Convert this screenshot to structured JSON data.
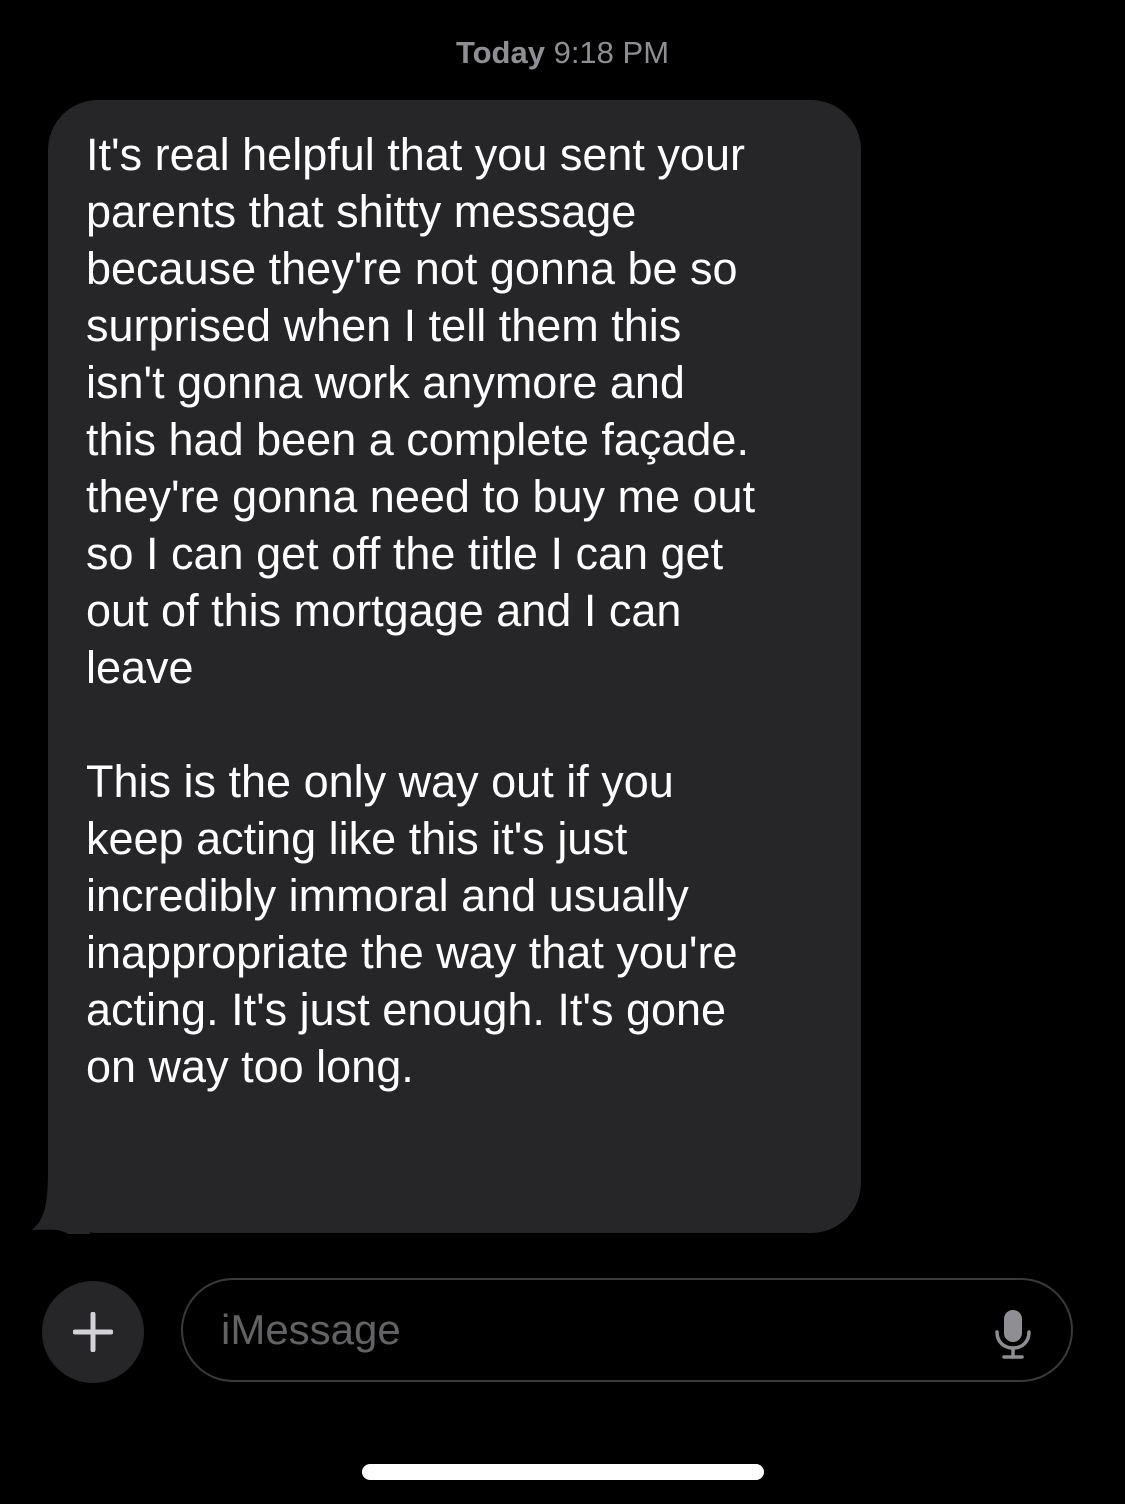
{
  "conversation": {
    "timestamp_day": "Today",
    "timestamp_time": "9:18 PM"
  },
  "message": {
    "direction": "incoming",
    "paragraph_1": "It's real helpful that you sent your\nparents that shitty message\nbecause they're not gonna be so\nsurprised when I tell them this\nisn't gonna work anymore and\nthis had been a complete façade.\nthey're gonna need to buy me out\nso I can get off the title I can get\nout of this mortgage and I can\nleave",
    "paragraph_2": "This is the only way out if you\nkeep acting like this it's just\nincredibly immoral and usually\ninappropriate the way that you're\nacting. It's just enough. It's gone\non way too long."
  },
  "composer": {
    "plus_icon": "plus-icon",
    "placeholder": "iMessage",
    "mic_icon": "microphone-icon"
  },
  "colors": {
    "background": "#000000",
    "bubble": "#262628",
    "timestamp": "#8e8e93",
    "placeholder": "#636366",
    "input_border": "#3a3a3c"
  }
}
